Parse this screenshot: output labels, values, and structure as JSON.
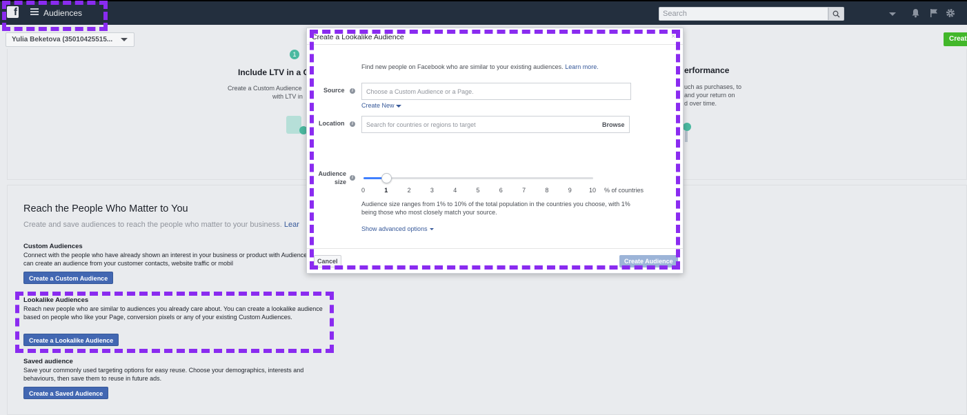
{
  "header": {
    "app_title": "Audiences",
    "search_placeholder": "Search"
  },
  "account": {
    "name": "Yulia Beketova (35010425515..."
  },
  "top_button": "Create",
  "top_panel": {
    "left": {
      "step": "1",
      "title": "Include LTV in a Cu",
      "desc_line1": "Create a Custom Audience",
      "desc_line2": "with LTV in"
    },
    "right": {
      "title": "erformance",
      "desc_line1": "uch as purchases, to",
      "desc_line2": "and your return on",
      "desc_line3": "d over time."
    }
  },
  "main": {
    "title": "Reach the People Who Matter to You",
    "subtitle": "Create and save audiences to reach the people who matter to your business.",
    "subtitle_link": "Lear",
    "custom": {
      "heading": "Custom Audiences",
      "desc": "Connect with the people who have already shown an interest in your business or product with Audiences. You can create an audience from your customer contacts, website traffic or mobil",
      "button": "Create a Custom Audience"
    },
    "lookalike": {
      "heading": "Lookalike Audiences",
      "desc": "Reach new people who are similar to audiences you already care about. You can create a lookalike audience based on people who like your Page, conversion pixels or any of your existing Custom Audiences.",
      "button": "Create a Lookalike Audience"
    },
    "saved": {
      "heading": "Saved audience",
      "desc": "Save your commonly used targeting options for easy reuse. Choose your demographics, interests and behaviours, then save them to reuse in future ads.",
      "button": "Create a Saved Audience"
    }
  },
  "modal": {
    "title": "Create a Lookalike Audience",
    "close": "×",
    "intro": "Find new people on Facebook who are similar to your existing audiences.",
    "intro_link": "Learn more.",
    "source_label": "Source",
    "source_placeholder": "Choose a Custom Audience or a Page.",
    "create_new": "Create New",
    "location_label": "Location",
    "location_placeholder": "Search for countries or regions to target",
    "browse": "Browse",
    "size_label_1": "Audience",
    "size_label_2": "size",
    "slider_ticks": [
      "0",
      "1",
      "2",
      "3",
      "4",
      "5",
      "6",
      "7",
      "8",
      "9",
      "10"
    ],
    "slider_value": 1,
    "slider_min": 0,
    "slider_max": 10,
    "pct_label": "% of countries",
    "size_note": "Audience size ranges from 1% to 10% of the total population in the countries you choose, with 1% being those who most closely match your source.",
    "advanced": "Show advanced options",
    "cancel": "Cancel",
    "create": "Create Audience"
  },
  "colors": {
    "topbar": "#232f3e",
    "primary_button": "#4267b2",
    "link": "#365899",
    "annotation": "#8a2bf0",
    "slider": "#4080ff"
  }
}
